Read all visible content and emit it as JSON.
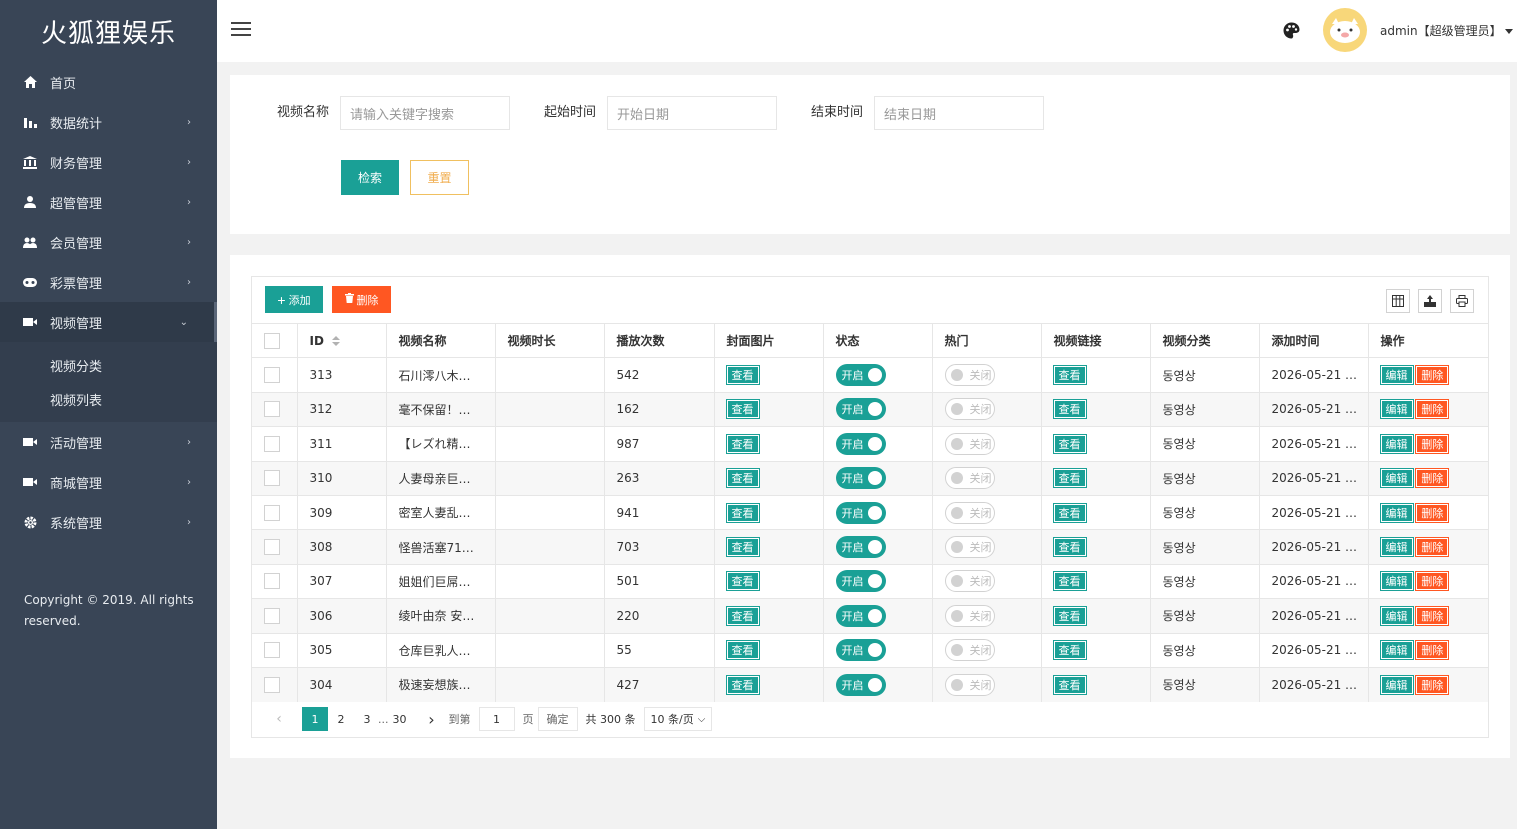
{
  "sidebar": {
    "logo": "火狐狸娱乐",
    "items": [
      {
        "label": "首页",
        "icon": "home-icon"
      },
      {
        "label": "数据统计",
        "icon": "bar-chart-icon"
      },
      {
        "label": "财务管理",
        "icon": "bank-icon"
      },
      {
        "label": "超管管理",
        "icon": "user-icon"
      },
      {
        "label": "会员管理",
        "icon": "users-icon"
      },
      {
        "label": "彩票管理",
        "icon": "gamepad-icon"
      },
      {
        "label": "视频管理",
        "icon": "video-icon"
      }
    ],
    "sub_items": [
      "视频分类",
      "视频列表"
    ],
    "items_after": [
      {
        "label": "活动管理",
        "icon": "video-icon"
      },
      {
        "label": "商城管理",
        "icon": "video-icon"
      },
      {
        "label": "系统管理",
        "icon": "gear-icon"
      }
    ],
    "copyright": "Copyright © 2019. All rights reserved."
  },
  "header": {
    "user": "admin【超级管理员】"
  },
  "search": {
    "name_label": "视频名称",
    "name_placeholder": "请输入关键字搜索",
    "start_label": "起始时间",
    "start_placeholder": "开始日期",
    "end_label": "结束时间",
    "end_placeholder": "结束日期",
    "search_btn": "检索",
    "reset_btn": "重置"
  },
  "toolbar": {
    "add": "添加",
    "delete": "删除"
  },
  "table": {
    "headers": [
      "ID",
      "视频名称",
      "视频时长",
      "播放次数",
      "封面图片",
      "状态",
      "热门",
      "视频链接",
      "视频分类",
      "添加时间",
      "操作"
    ],
    "view_label": "查看",
    "on_label": "开启",
    "off_label": "关闭",
    "edit_label": "编辑",
    "del_label": "删除",
    "rows": [
      {
        "id": "313",
        "name": "石川澪八木…",
        "duration": "",
        "plays": "542",
        "category": "동영상",
        "time": "2026-05-21 …"
      },
      {
        "id": "312",
        "name": "毫不保留！…",
        "duration": "",
        "plays": "162",
        "category": "동영상",
        "time": "2026-05-21 …"
      },
      {
        "id": "311",
        "name": "【レズれ精…",
        "duration": "",
        "plays": "987",
        "category": "동영상",
        "time": "2026-05-21 …"
      },
      {
        "id": "310",
        "name": "人妻母亲巨…",
        "duration": "",
        "plays": "263",
        "category": "동영상",
        "time": "2026-05-21 …"
      },
      {
        "id": "309",
        "name": "密室人妻乱…",
        "duration": "",
        "plays": "941",
        "category": "동영상",
        "time": "2026-05-21 …"
      },
      {
        "id": "308",
        "name": "怪兽活塞71…",
        "duration": "",
        "plays": "703",
        "category": "동영상",
        "time": "2026-05-21 …"
      },
      {
        "id": "307",
        "name": "姐姐们巨屌…",
        "duration": "",
        "plays": "501",
        "category": "동영상",
        "time": "2026-05-21 …"
      },
      {
        "id": "306",
        "name": "绫叶由奈 安…",
        "duration": "",
        "plays": "220",
        "category": "동영상",
        "time": "2026-05-21 …"
      },
      {
        "id": "305",
        "name": "仓库巨乳人…",
        "duration": "",
        "plays": "55",
        "category": "동영상",
        "time": "2026-05-21 …"
      },
      {
        "id": "304",
        "name": "极速妄想族…",
        "duration": "",
        "plays": "427",
        "category": "동영상",
        "time": "2026-05-21 …"
      }
    ]
  },
  "pager": {
    "pages": [
      "1",
      "2",
      "3",
      "...",
      "30"
    ],
    "goto_label": "到第",
    "goto_value": "1",
    "page_unit": "页",
    "ok": "确定",
    "total": "共 300 条",
    "per_page": "10 条/页"
  },
  "colors": {
    "primary": "#1aa096",
    "danger": "#ff5722",
    "sidebar": "#394556"
  }
}
